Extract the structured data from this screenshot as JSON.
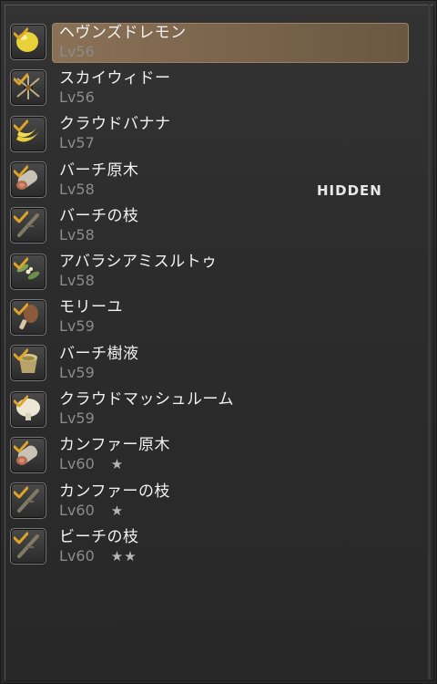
{
  "items": [
    {
      "name": "ヘヴンズドレモン",
      "level": "Lv56",
      "stars": "",
      "icon": "lemon-icon",
      "selected": true
    },
    {
      "name": "スカイウィドー",
      "level": "Lv56",
      "stars": "",
      "icon": "spider-plant-icon",
      "selected": false
    },
    {
      "name": "クラウドバナナ",
      "level": "Lv57",
      "stars": "",
      "icon": "banana-icon",
      "selected": false
    },
    {
      "name": "バーチ原木",
      "level": "Lv58",
      "stars": "",
      "icon": "log-icon",
      "selected": false
    },
    {
      "name": "バーチの枝",
      "level": "Lv58",
      "stars": "",
      "icon": "branch-icon",
      "selected": false
    },
    {
      "name": "アバラシアミスルトゥ",
      "level": "Lv58",
      "stars": "",
      "icon": "mistletoe-icon",
      "selected": false
    },
    {
      "name": "モリーユ",
      "level": "Lv59",
      "stars": "",
      "icon": "morel-icon",
      "selected": false
    },
    {
      "name": "バーチ樹液",
      "level": "Lv59",
      "stars": "",
      "icon": "sap-bucket-icon",
      "selected": false
    },
    {
      "name": "クラウドマッシュルーム",
      "level": "Lv59",
      "stars": "",
      "icon": "mushroom-icon",
      "selected": false
    },
    {
      "name": "カンファー原木",
      "level": "Lv60",
      "stars": "★",
      "icon": "log-icon",
      "selected": false
    },
    {
      "name": "カンファーの枝",
      "level": "Lv60",
      "stars": "★",
      "icon": "branch-icon",
      "selected": false
    },
    {
      "name": "ビーチの枝",
      "level": "Lv60",
      "stars": "★★",
      "icon": "branch-icon",
      "selected": false
    }
  ],
  "overlay": {
    "hidden_label": "HIDDEN"
  },
  "colors": {
    "check": "#e0a526",
    "selected_bg": "#7d6a53"
  }
}
